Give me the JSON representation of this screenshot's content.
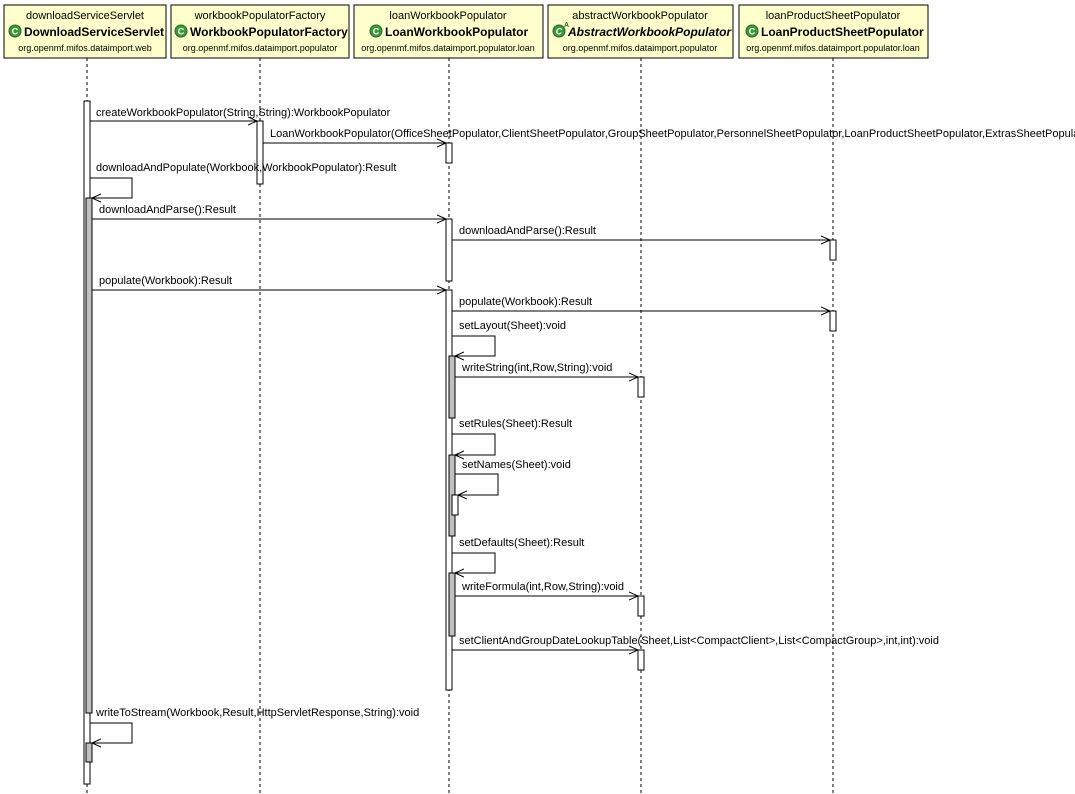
{
  "participants": [
    {
      "key": "servlet",
      "role": "downloadServiceServlet",
      "name": "DownloadServiceServlet",
      "package": "org.openmf.mifos.dataimport.web",
      "icon": "class-icon",
      "abstract": false
    },
    {
      "key": "factory",
      "role": "workbookPopulatorFactory",
      "name": "WorkbookPopulatorFactory",
      "package": "org.openmf.mifos.dataimport.populator",
      "icon": "class-icon",
      "abstract": false
    },
    {
      "key": "loanwb",
      "role": "loanWorkbookPopulator",
      "name": "LoanWorkbookPopulator",
      "package": "org.openmf.mifos.dataimport.populator.loan",
      "icon": "class-icon",
      "abstract": false
    },
    {
      "key": "abstractwb",
      "role": "abstractWorkbookPopulator",
      "name": "AbstractWorkbookPopulator",
      "package": "org.openmf.mifos.dataimport.populator",
      "icon": "abstract-class-icon",
      "abstract": true
    },
    {
      "key": "loanprod",
      "role": "loanProductSheetPopulator",
      "name": "LoanProductSheetPopulator",
      "package": "org.openmf.mifos.dataimport.populator.loan",
      "icon": "class-icon",
      "abstract": false
    }
  ],
  "messages": [
    {
      "from": "servlet",
      "to": "factory",
      "label": "createWorkbookPopulator(String,String):WorkbookPopulator"
    },
    {
      "from": "factory",
      "to": "loanwb",
      "label": "LoanWorkbookPopulator(OfficeSheetPopulator,ClientSheetPopulator,GroupSheetPopulator,PersonnelSheetPopulator,LoanProductSheetPopulator,ExtrasSheetPopulator)"
    },
    {
      "from": "servlet",
      "to": "servlet",
      "label": "downloadAndPopulate(Workbook,WorkbookPopulator):Result"
    },
    {
      "from": "servlet",
      "to": "loanwb",
      "label": "downloadAndParse():Result"
    },
    {
      "from": "loanwb",
      "to": "loanprod",
      "label": "downloadAndParse():Result"
    },
    {
      "from": "servlet",
      "to": "loanwb",
      "label": "populate(Workbook):Result"
    },
    {
      "from": "loanwb",
      "to": "loanprod",
      "label": "populate(Workbook):Result"
    },
    {
      "from": "loanwb",
      "to": "loanwb",
      "label": "setLayout(Sheet):void"
    },
    {
      "from": "loanwb",
      "to": "abstractwb",
      "label": "writeString(int,Row,String):void"
    },
    {
      "from": "loanwb",
      "to": "loanwb",
      "label": "setRules(Sheet):Result"
    },
    {
      "from": "loanwb",
      "to": "loanwb",
      "label": "setNames(Sheet):void"
    },
    {
      "from": "loanwb",
      "to": "loanwb",
      "label": "setDefaults(Sheet):Result"
    },
    {
      "from": "loanwb",
      "to": "abstractwb",
      "label": "writeFormula(int,Row,String):void"
    },
    {
      "from": "loanwb",
      "to": "abstractwb",
      "label": "setClientAndGroupDateLookupTable(Sheet,List<CompactClient>,List<CompactGroup>,int,int):void"
    },
    {
      "from": "servlet",
      "to": "servlet",
      "label": "writeToStream(Workbook,Result,HttpServletResponse,String):void"
    }
  ],
  "colors": {
    "header_fill": "#ffffcc",
    "activation_fill": "#ffffff",
    "nested_activation_fill": "#c0c0c0",
    "class_icon": "#3a9a3a"
  }
}
